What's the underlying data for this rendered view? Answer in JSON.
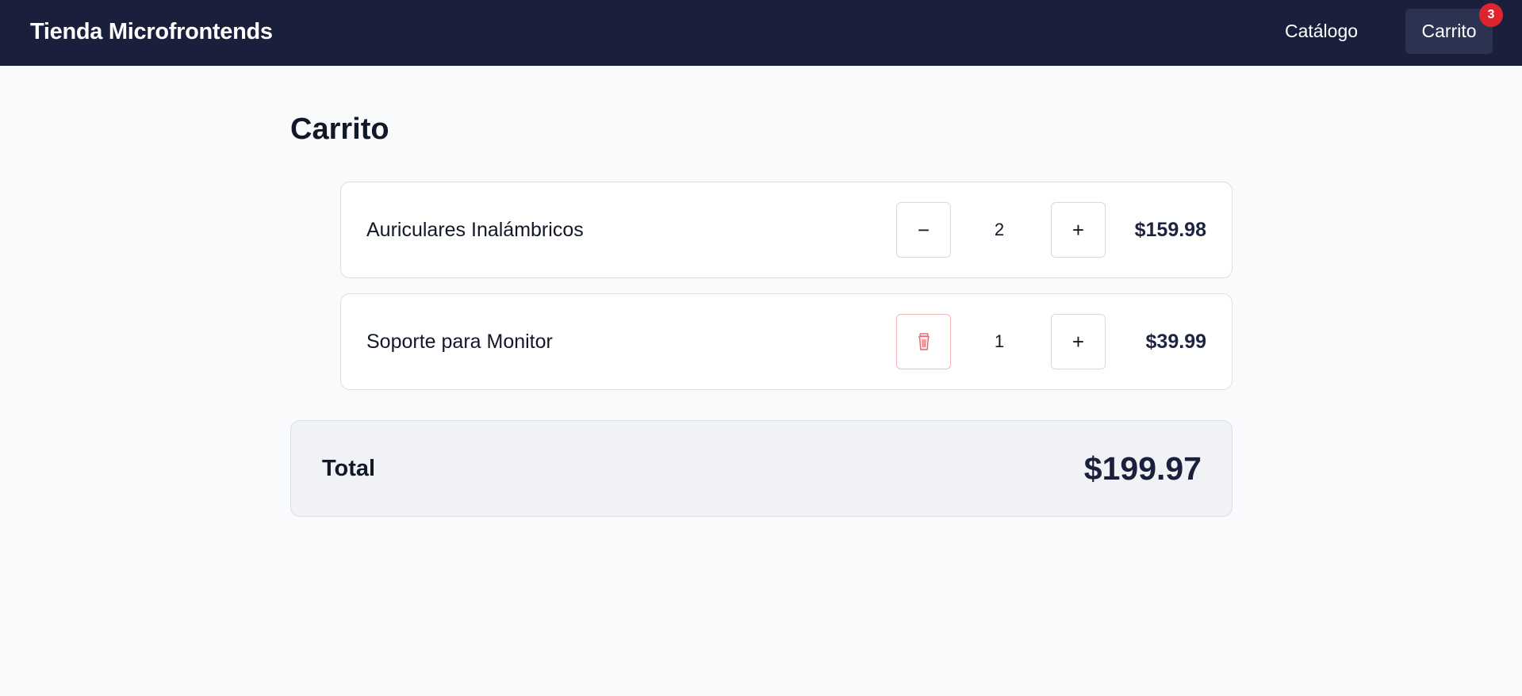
{
  "header": {
    "brand": "Tienda Microfrontends",
    "nav": {
      "catalog_label": "Catálogo",
      "cart_label": "Carrito",
      "cart_badge": "3"
    }
  },
  "page": {
    "title": "Carrito"
  },
  "cart": {
    "items": [
      {
        "name": "Auriculares Inalámbricos",
        "quantity": "2",
        "decrease_label": "−",
        "increase_label": "+",
        "price": "$159.98"
      },
      {
        "name": "Soporte para Monitor",
        "quantity": "1",
        "remove_icon": "trash-icon",
        "increase_label": "+",
        "price": "$39.99"
      }
    ],
    "total_label": "Total",
    "total_value": "$199.97"
  },
  "colors": {
    "header_bg": "#1a203c",
    "cart_button_bg": "#2c3350",
    "badge_bg": "#e0242e",
    "page_bg": "#f9fafc",
    "total_bg": "#f1f2f5",
    "remove_accent": "#e36a70"
  }
}
